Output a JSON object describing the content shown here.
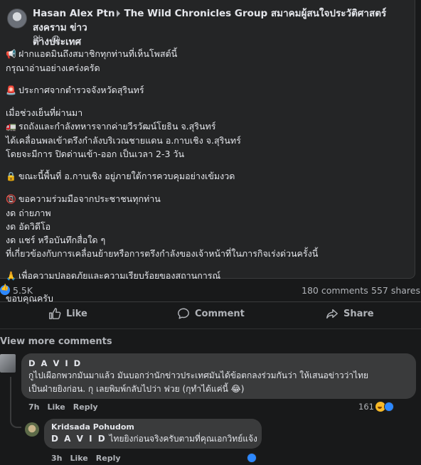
{
  "post": {
    "author": "Hasan Alex Ptn",
    "group": "The Wild Chronicles Group สมาคมผู้สนใจประวัติศาสตร์ สงคราม ข่าว",
    "group_cont": "ต่างประเทศ",
    "time": "8h ·",
    "lines": [
      {
        "emoji": "📢",
        "text": "ฝากแอดมินถึงสมาชิกทุกท่านที่เห็นโพสต์นี้"
      },
      {
        "emoji": "",
        "text": "กรุณาอ่านอย่างเคร่งครัด"
      },
      {
        "emoji": "🚨",
        "text": "ประกาศจากตำรวจจังหวัดสุรินทร์"
      },
      {
        "emoji": "",
        "text": "เมื่อช่วงเย็นที่ผ่านมา"
      },
      {
        "emoji": "🚛",
        "text": "รถถังและกำลังทหารจากค่ายวีรวัฒน์โยธิน จ.สุรินทร์"
      },
      {
        "emoji": "",
        "text": "ได้เคลื่อนพลเข้าตรึงกำลังบริเวณชายแดน อ.กาบเชิง จ.สุรินทร์"
      },
      {
        "emoji": "",
        "text": "โดยจะมีการ ปิดด่านเข้า-ออก เป็นเวลา 2-3 วัน"
      },
      {
        "emoji": "🔒",
        "text": "ขณะนี้พื้นที่ อ.กาบเชิง อยู่ภายใต้การควบคุมอย่างเข้มงวด"
      },
      {
        "emoji": "📵",
        "text": "ขอความร่วมมือจากประชาชนทุกท่าน"
      },
      {
        "emoji": "",
        "text": "งด ถ่ายภาพ"
      },
      {
        "emoji": "",
        "text": "งด อัดวิดีโอ"
      },
      {
        "emoji": "",
        "text": "งด แชร์ หรือบันทึกสื่อใด ๆ"
      },
      {
        "emoji": "",
        "text": "ที่เกี่ยวข้องกับการเคลื่อนย้ายหรือการตรึงกำลังของเจ้าหน้าที่ในภารกิจเร่งด่วนครั้งนี้"
      },
      {
        "emoji": "🙏",
        "text": "เพื่อความปลอดภัยและความเรียบร้อยของสถานการณ์"
      },
      {
        "emoji": "",
        "text": "ขอบคุณครับ"
      }
    ]
  },
  "stats": {
    "reactions": "5.5K",
    "comments": "180 comments",
    "shares": "557 shares"
  },
  "actions": {
    "like": "Like",
    "comment": "Comment",
    "share": "Share"
  },
  "view_more": "View more comments",
  "comment1": {
    "name": "D A V I D",
    "line1": "กูไปเผือกพวกมันมาแล้ว มันบอกว่านักข่าวประเทศมันได้ข้อตกลงร่วมกันว่า ให้เสนอข่าวว่าไทย",
    "line2": "เป็นฝ่ายยิงก่อน. กุ เลยพิมพ์กลับไปว่า ฟวย (กุทำได้แค่นี้ 😂)",
    "time": "7h",
    "like": "Like",
    "reply": "Reply",
    "reactions": "161"
  },
  "comment2": {
    "name": "Kridsada Pohudom",
    "tag": "D A V I D",
    "text": "ไทยยิงก่อนจริงครับตามที่คุณเอกวิทย์แจ้ง",
    "time": "3h",
    "like": "Like",
    "reply": "Reply"
  }
}
